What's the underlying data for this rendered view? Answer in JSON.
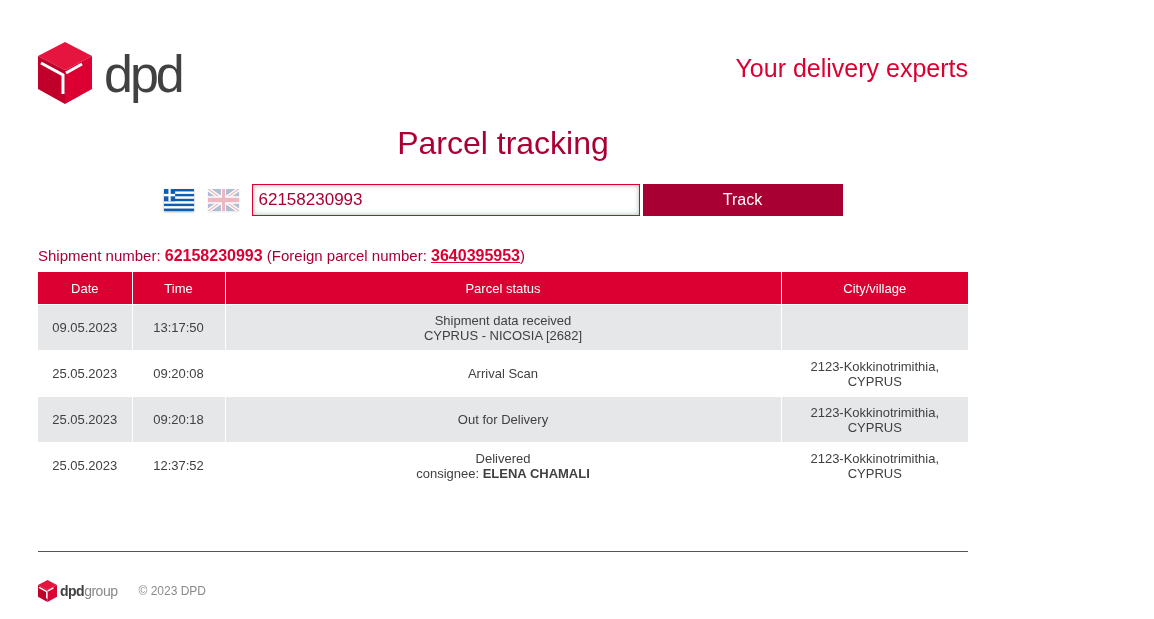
{
  "header": {
    "logo_text": "dpd",
    "tagline": "Your delivery experts"
  },
  "title": "Parcel tracking",
  "search": {
    "languages": [
      {
        "kind": "greece",
        "selected": false
      },
      {
        "kind": "uk",
        "selected": true
      }
    ],
    "value": "62158230993",
    "button": "Track"
  },
  "shipment": {
    "label": "Shipment number:",
    "number": "62158230993",
    "foreign_label": "(Foreign parcel number:",
    "foreign_number": "3640395953",
    "tail": ")"
  },
  "table": {
    "columns": [
      "Date",
      "Time",
      "Parcel status",
      "City/village"
    ],
    "rows": [
      {
        "date": "09.05.2023",
        "time": "13:17:50",
        "status": [
          "Shipment data received",
          "CYPRUS - NICOSIA [2682]"
        ]
      },
      {
        "date": "25.05.2023",
        "time": "09:20:08",
        "status": [
          "Arrival Scan"
        ],
        "city": [
          "2123-Kokkinotrimithia,",
          "CYPRUS"
        ]
      },
      {
        "date": "25.05.2023",
        "time": "09:20:18",
        "status": [
          "Out for Delivery"
        ],
        "city": [
          "2123-Kokkinotrimithia,",
          "CYPRUS"
        ]
      },
      {
        "date": "25.05.2023",
        "time": "12:37:52",
        "status": [
          "Delivered",
          "consignee: **ELENA CHAMALI**"
        ],
        "city": [
          "2123-Kokkinotrimithia,",
          "CYPRUS"
        ]
      }
    ]
  },
  "footer": {
    "logo": "**dpd**group",
    "copyright": "© 2023 DPD"
  }
}
